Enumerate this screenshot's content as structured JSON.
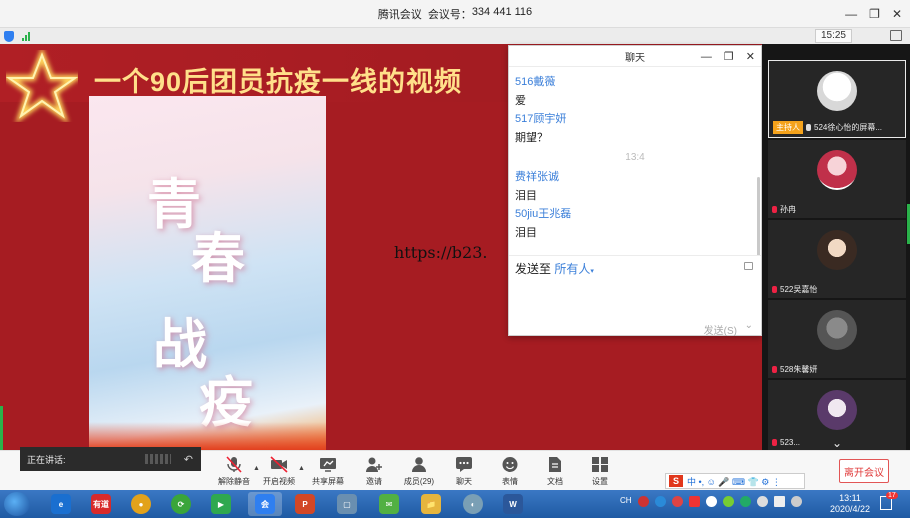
{
  "window": {
    "title_app": "腾讯会议",
    "title_meeting_label": "会议号：",
    "title_meeting_id": "334 441 116",
    "min": "—",
    "restore": "❐",
    "close": "✕"
  },
  "status": {
    "time": "15:25"
  },
  "stage": {
    "headline": "一个90后团员抗疫一线的视频",
    "poster_chars": [
      "青",
      "春",
      "战",
      "疫"
    ],
    "url_text": "https://b23."
  },
  "chat": {
    "title": "聊天",
    "messages": [
      {
        "name": "516戴薇",
        "text": "爱"
      },
      {
        "name": "517顾宇妍",
        "text": "期望？"
      },
      {
        "time": "13:4"
      },
      {
        "name": "费祥张诚",
        "text": "泪目"
      },
      {
        "name": "50jiu王兆磊",
        "text": "泪目"
      }
    ],
    "send_to_label": "发送至",
    "send_to_target": "所有人",
    "send_button": "发送(S)",
    "send_more": "⌄"
  },
  "videos": [
    {
      "label": "524徐心怡的屏幕...",
      "host": "主持人"
    },
    {
      "label": "孙冉"
    },
    {
      "label": "522吴嘉怡"
    },
    {
      "label": "528朱馨妍"
    },
    {
      "label": "523..."
    }
  ],
  "videos_more": "⌄",
  "toolbar": {
    "speaking_label": "正在讲话:",
    "speaking_end": "↶",
    "buttons": [
      {
        "label": "解除静音"
      },
      {
        "label": "开启视频"
      },
      {
        "label": "共享屏幕"
      },
      {
        "label": "邀请"
      },
      {
        "label": "成员(29)"
      },
      {
        "label": "聊天"
      },
      {
        "label": "表情"
      },
      {
        "label": "文档"
      },
      {
        "label": "设置"
      }
    ],
    "leave": "离开会议",
    "ime_logo": "S",
    "ime_text": "中 •, ☺ 🎤 ⌨ 👕 ⚙ ⋮"
  },
  "taskbar": {
    "apps": [
      {
        "label": "e",
        "color": "#1a6fd0"
      },
      {
        "label": "有道",
        "color": "#d82a2a"
      },
      {
        "label": "●",
        "color": "#e2a21b"
      },
      {
        "label": "⟳",
        "color": "#3aa53a"
      },
      {
        "label": "▶",
        "color": "#2fa84f"
      },
      {
        "label": "会",
        "color": "#2f7ff0"
      },
      {
        "label": "P",
        "color": "#d24726"
      },
      {
        "label": "▢",
        "color": "#6a8fb0"
      },
      {
        "label": "✉",
        "color": "#52b043"
      },
      {
        "label": "📁",
        "color": "#e6b53d"
      },
      {
        "label": "◐",
        "color": "#7a9fb5"
      },
      {
        "label": "W",
        "color": "#2b579a"
      }
    ],
    "tray_lang": "CH",
    "time": "13:11",
    "date": "2020/4/22",
    "notif_count": "17"
  }
}
